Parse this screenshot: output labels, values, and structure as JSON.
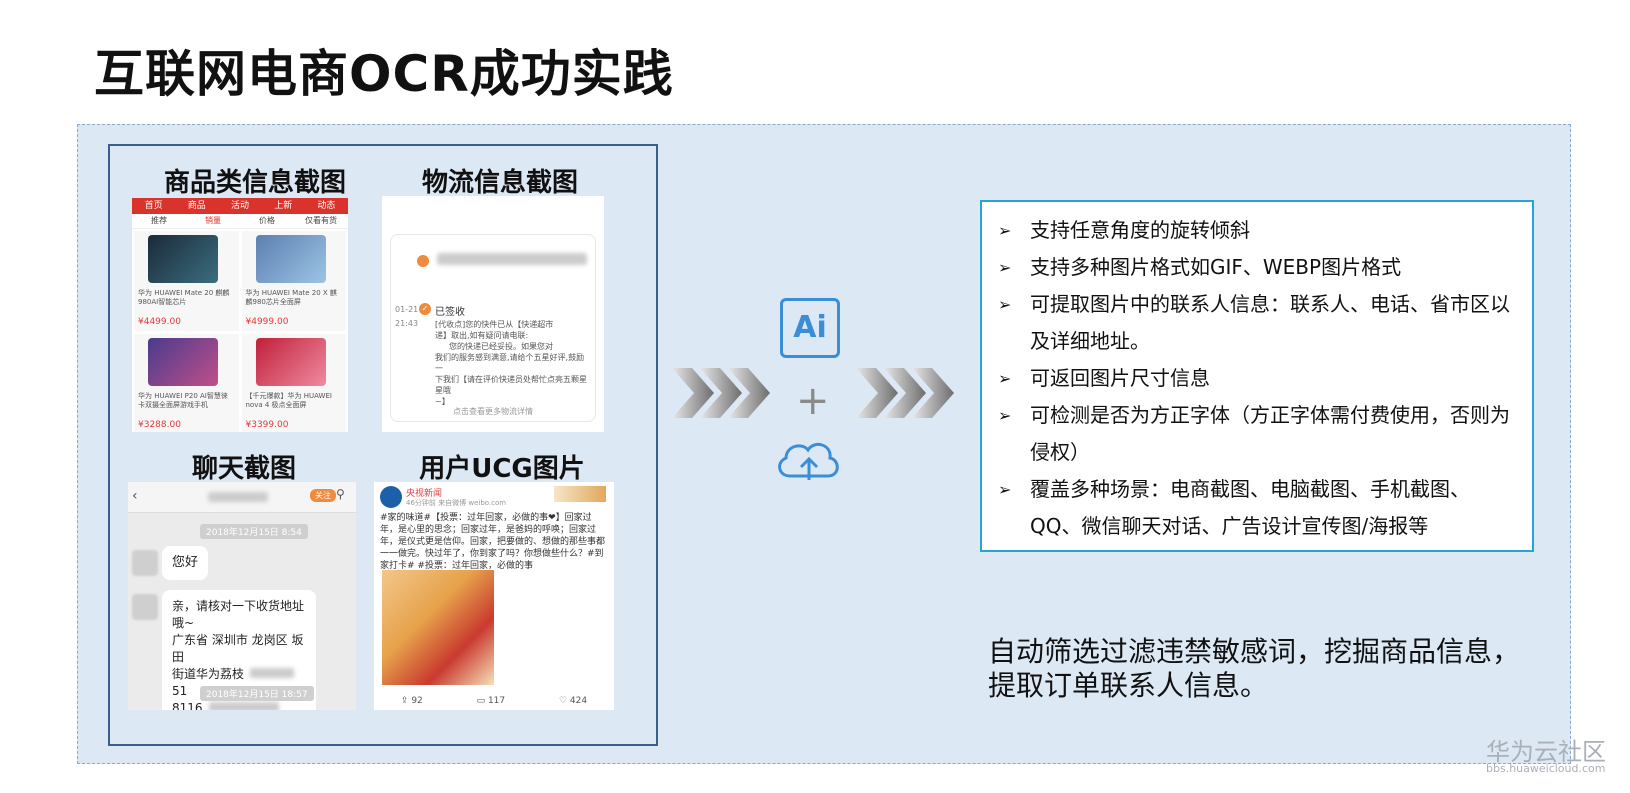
{
  "title": "互联网电商OCR成功实践",
  "screenshots": {
    "product_label": "商品类信息截图",
    "logistics_label": "物流信息截图",
    "chat_label": "聊天截图",
    "ugc_label": "用户UCG图片"
  },
  "product": {
    "tabs": [
      "首页",
      "商品",
      "活动",
      "上新",
      "动态"
    ],
    "sort": [
      "推荐",
      "销量",
      "价格",
      "仅看有货"
    ],
    "items": [
      {
        "name": "华为 HUAWEI Mate 20 麒麟980AI智能芯片",
        "price": "¥4499.00"
      },
      {
        "name": "华为 HUAWEI Mate 20 X 麒麟980芯片全面屏",
        "price": "¥4999.00"
      },
      {
        "name": "华为 HUAWEI P20 AI智慧徕卡双摄全面屏游戏手机",
        "price": "¥3288.00"
      },
      {
        "name": "【千元爆款】华为 HUAWEI nova 4 极点全面屏",
        "price": "¥3399.00"
      }
    ]
  },
  "logistics": {
    "date": "01-21",
    "time": "21:43",
    "status": "已签收",
    "line1": "[代收点]您的快件已从【快递超市",
    "line2": "递】取出,如有疑问请电联:",
    "line3": "您的快递已经妥投。如果您对",
    "line4": "我们的服务感到满意,请给个五星好评,鼓励一",
    "line5": "下我们【请在评价快递员处帮忙点亮五颗星星哦",
    "line6": "~】",
    "more": "点击查看更多物流详情"
  },
  "chat": {
    "follow": "关注",
    "stamp1": "2018年12月15日 8:54",
    "hello": "您好",
    "msg_line1": "亲，请核对一下收货地址哦~",
    "msg_line2": "广东省 深圳市 龙岗区 坂田",
    "msg_line3": "街道华为荔枝",
    "msg_line3b": "51",
    "msg_line4": "8116",
    "stamp2": "2018年12月15日 18:57"
  },
  "ugc": {
    "account": "央视新闻",
    "meta": "46分钟前 来自微博 weibo.com",
    "text": "#家的味道#【投票：过年回家，必做的事❤】回家过年，是心里的思念；回家过年，是爸妈的呼唤；回家过年，是仪式更是信仰。回家，把要做的、想做的那些事都一一做完。快过年了，你到家了吗？你想做些什么？#到家打卡# #投票：过年回家，必做的事",
    "shares": "92",
    "comments": "117",
    "likes": "424"
  },
  "ai_icon_text": "Ai",
  "features": [
    "支持任意角度的旋转倾斜",
    "支持多种图片格式如GIF、WEBP图片格式",
    "可提取图片中的联系人信息：联系人、电话、省市区以",
    "及详细地址。",
    "可返回图片尺寸信息",
    "可检测是否为方正字体（方正字体需付费使用，否则为",
    "侵权）",
    "覆盖多种场景：电商截图、电脑截图、手机截图、",
    "QQ、微信聊天对话、广告设计宣传图/海报等"
  ],
  "summary_line1": "自动筛选过滤违禁敏感词，挖掘商品信息，",
  "summary_line2": "提取订单联系人信息。",
  "brand": "华为云社区",
  "brand_url": "bbs.huaweicloud.com",
  "colors": {
    "panel_bg": "#dde8f5",
    "feature_border": "#29a3d6",
    "accent_blue": "#3b8ed6",
    "red": "#d9332b"
  }
}
